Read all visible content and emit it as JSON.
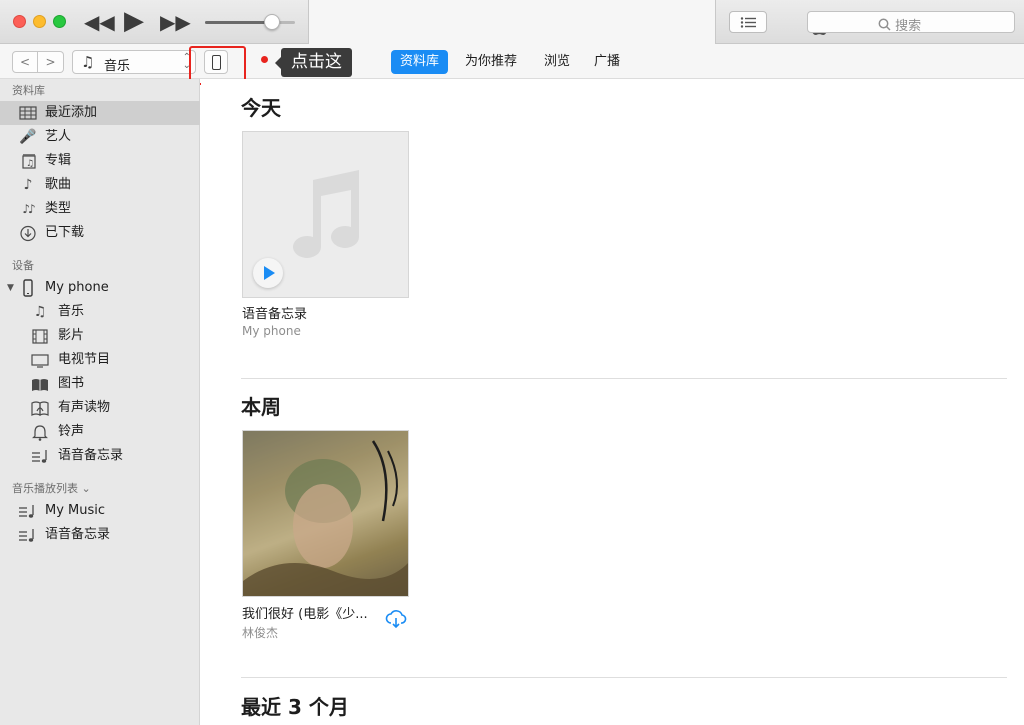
{
  "window": {
    "search_placeholder": "搜索",
    "volume_fraction": 0.74,
    "icons": [
      "rewind-icon",
      "play-icon",
      "fast-forward-icon",
      "apple-logo-icon",
      "list-view-icon",
      "search-icon"
    ]
  },
  "nav": {
    "back_symbol": "<",
    "forward_symbol": ">",
    "media_type": "音乐",
    "media_icon": "♫",
    "annotation": "点击这",
    "tabs": [
      {
        "label": "资料库",
        "active": true
      },
      {
        "label": "为你推荐",
        "active": false
      },
      {
        "label": "浏览",
        "active": false
      },
      {
        "label": "广播",
        "active": false
      }
    ],
    "accent_color": "#1a8cf4",
    "highlight_color": "#e8241e"
  },
  "sidebar": {
    "library_heading": "资料库",
    "library_items": [
      {
        "label": "最近添加",
        "icon": "grid-icon",
        "selected": true
      },
      {
        "label": "艺人",
        "icon": "microphone-icon",
        "selected": false
      },
      {
        "label": "专辑",
        "icon": "album-icon",
        "selected": false
      },
      {
        "label": "歌曲",
        "icon": "note-icon",
        "selected": false
      },
      {
        "label": "类型",
        "icon": "genre-icon",
        "selected": false
      },
      {
        "label": "已下载",
        "icon": "download-clock-icon",
        "selected": false
      }
    ],
    "devices_heading": "设备",
    "device_name": "My phone",
    "device_items": [
      {
        "label": "音乐",
        "icon": "note-icon"
      },
      {
        "label": "影片",
        "icon": "film-icon"
      },
      {
        "label": "电视节目",
        "icon": "tv-icon"
      },
      {
        "label": "图书",
        "icon": "book-icon"
      },
      {
        "label": "有声读物",
        "icon": "audiobook-icon"
      },
      {
        "label": "铃声",
        "icon": "bell-icon"
      },
      {
        "label": "语音备忘录",
        "icon": "playlist-icon"
      }
    ],
    "playlists_heading": "音乐播放列表",
    "playlists_chevron": "⌄",
    "playlists": [
      {
        "label": "My Music",
        "icon": "playlist-icon"
      },
      {
        "label": "语音备忘录",
        "icon": "playlist-icon"
      }
    ]
  },
  "content": {
    "sections": [
      {
        "title": "今天",
        "album": {
          "title": "语音备忘录",
          "subtitle": "My phone"
        }
      },
      {
        "title": "本周",
        "album": {
          "title": "我们很好 (电影《少...",
          "subtitle": "林俊杰"
        }
      },
      {
        "title": "最近 3 个月"
      }
    ]
  }
}
